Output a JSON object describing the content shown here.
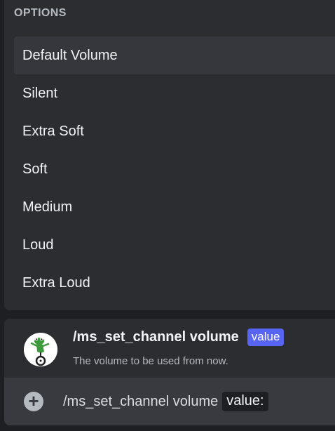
{
  "options": {
    "header": "OPTIONS",
    "items": [
      {
        "label": "Default Volume"
      },
      {
        "label": "Silent"
      },
      {
        "label": "Extra Soft"
      },
      {
        "label": "Soft"
      },
      {
        "label": "Medium"
      },
      {
        "label": "Loud"
      },
      {
        "label": "Extra Loud"
      }
    ]
  },
  "command": {
    "name": "/ms_set_channel volume",
    "param_chip": "value",
    "description": "The volume to be used from now.",
    "avatar_icon": "frog-unicycle-avatar"
  },
  "chat_input": {
    "plus_icon": "plus-circle-icon",
    "text": "/ms_set_channel volume",
    "param": "value:"
  },
  "colors": {
    "background": "#1e1f22",
    "panel": "#2b2d31",
    "selected": "#35373c",
    "input": "#383a40",
    "accent": "#5865f2"
  }
}
